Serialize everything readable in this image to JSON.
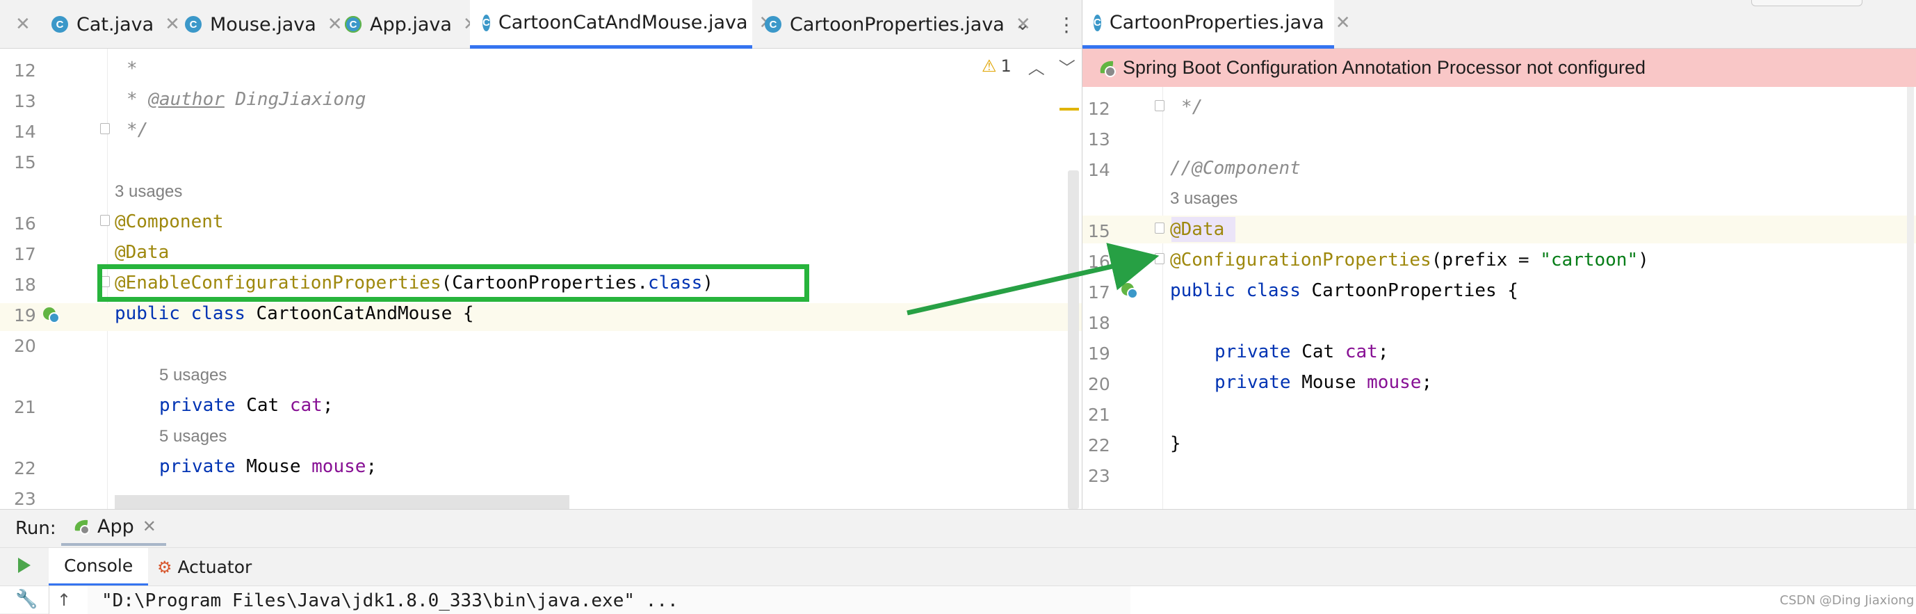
{
  "left_tabs": [
    {
      "label": "Cat.java",
      "active": false
    },
    {
      "label": "Mouse.java",
      "active": false
    },
    {
      "label": "App.java",
      "active": false
    },
    {
      "label": "CartoonCatAndMouse.java",
      "active": true
    },
    {
      "label": "CartoonProperties.java",
      "active": false
    }
  ],
  "right_tabs": [
    {
      "label": "CartoonProperties.java",
      "active": true
    }
  ],
  "left_editor": {
    "warning_count": "1",
    "line_numbers": [
      "12",
      "13",
      "14",
      "15",
      "16",
      "17",
      "18",
      "19",
      "20",
      "21",
      "22",
      "23"
    ],
    "usages": [
      "3 usages",
      "5 usages",
      "5 usages"
    ],
    "code": {
      "l12": "*",
      "l13_star": "* ",
      "l13_tag": "@author",
      "l13_name": " DingJiaxiong",
      "l14": "*/",
      "l16": "@Component",
      "l17": "@Data",
      "l18_ann": "@EnableConfigurationProperties",
      "l18_open": "(CartoonProperties.",
      "l18_class": "class",
      "l18_close": ")",
      "l19_kw1": "public",
      "l19_kw2": "class",
      "l19_rest": " CartoonCatAndMouse {",
      "l21_kw": "private",
      "l21_type": " Cat ",
      "l21_field": "cat",
      "l21_end": ";",
      "l22_kw": "private",
      "l22_type": " Mouse ",
      "l22_field": "mouse",
      "l22_end": ";"
    }
  },
  "right_editor": {
    "banner": "Spring Boot Configuration Annotation Processor not configured",
    "line_numbers": [
      "12",
      "13",
      "14",
      "15",
      "16",
      "17",
      "18",
      "19",
      "20",
      "21",
      "22",
      "23"
    ],
    "usages": [
      "3 usages"
    ],
    "code": {
      "l12": "*/",
      "l14": "//@Component",
      "l15": "@Data",
      "l16_ann": "@ConfigurationProperties",
      "l16_open": "(prefix = ",
      "l16_str": "\"cartoon\"",
      "l16_close": ")",
      "l17_kw1": "public",
      "l17_kw2": "class",
      "l17_rest": " CartoonProperties {",
      "l19_kw": "private",
      "l19_type": " Cat ",
      "l19_field": "cat",
      "l19_end": ";",
      "l20_kw": "private",
      "l20_type": " Mouse ",
      "l20_field": "mouse",
      "l20_end": ";",
      "l22": "}"
    }
  },
  "run_panel": {
    "label": "Run:",
    "config": "App",
    "tabs": [
      "Console",
      "Actuator"
    ],
    "output": "\"D:\\Program Files\\Java\\jdk1.8.0_333\\bin\\java.exe\" ..."
  },
  "watermark": "CSDN @Ding Jiaxiong",
  "colors": {
    "highlight_box": "#27b43c",
    "arrow": "#27a044",
    "banner_bg": "#f9c7c7",
    "active_tab_underline": "#3574f0"
  }
}
